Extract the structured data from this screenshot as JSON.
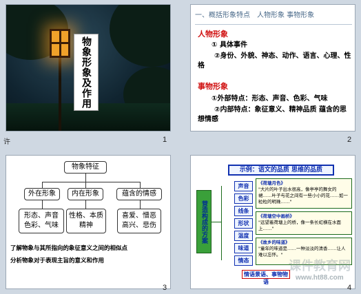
{
  "slide1": {
    "title": "物象形象及作用",
    "number": "1",
    "note": "许"
  },
  "slide2": {
    "number": "2",
    "heading": "一、概括形象特点　人物形象 事物形象",
    "section1_title": "人物形象",
    "item1": "①  具体事件",
    "item2": "②身份、外貌、神态、动作、语言、心理、性格",
    "section2_title": "事物形象",
    "item3": "①外部特点：形态、声音、色彩、气味",
    "item4": "②内部特点：象征意义、精神品质 蕴含的思想情感"
  },
  "slide3": {
    "number": "3",
    "root": "物象特征",
    "branches": [
      "外在形象",
      "内在形象",
      "蕴含的情感"
    ],
    "leaves": [
      "形态、声音\n色彩、气味",
      "性格、本质\n精神",
      "喜爱、憎恶\n高兴、悲伤"
    ],
    "footer1": "了解物象与其所指向的象征意义之间的相似点",
    "footer2": "分析物象对于表现主旨的意义和作用"
  },
  "slide4": {
    "number": "4",
    "banner": "示例：语文的品质  思维的品质",
    "side_label": "营造构成的方案",
    "tags": [
      "声音",
      "色彩",
      "线条",
      "形状",
      "温度",
      "味道",
      "情态"
    ],
    "panels": [
      {
        "head": "《荷塘月色》",
        "body": "\"大片的叶子出水很高，像亭亭的舞女的裙……叶子与花之间有一些小小的花……如一粒粒的明珠……\""
      },
      {
        "head": "《荷塘空中画桥》",
        "body": "\"远望着荷塘上的桥，像一条长虹横在水面上……\""
      },
      {
        "head": "《故乡的味道》",
        "body": "\"童年的味道是……一种淡淡的清香……让人难以忘怀。\""
      }
    ],
    "footer": "情语景语、事物物语",
    "watermark": "课件教育网",
    "watermark_url": "www.ht88.com"
  }
}
